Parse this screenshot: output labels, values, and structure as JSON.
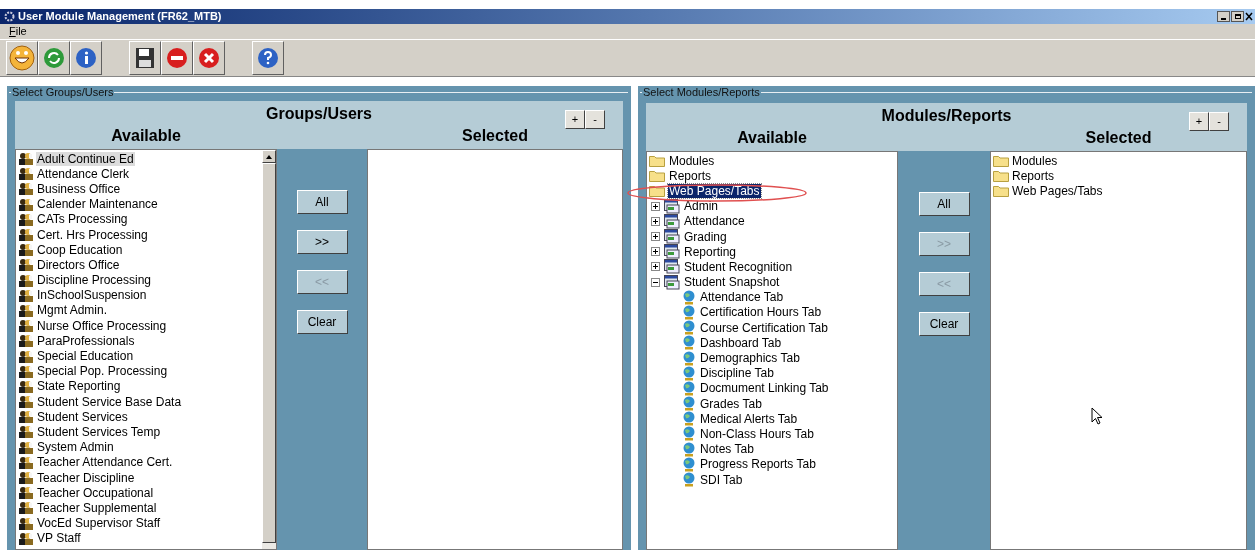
{
  "window": {
    "title": "User Module Management (FR62_MTB)"
  },
  "menu": [
    {
      "label": "File"
    }
  ],
  "groups_panel": {
    "legend": "Select Groups/Users",
    "title": "Groups/Users",
    "available_label": "Available",
    "selected_label": "Selected",
    "expand_button": "+",
    "collapse_button": "-",
    "available": [
      {
        "label": "Adult Continue Ed",
        "selected": true
      },
      {
        "label": "Attendance Clerk",
        "selected": false
      },
      {
        "label": "Business Office",
        "selected": false
      },
      {
        "label": "Calender Maintenance",
        "selected": false
      },
      {
        "label": "CATs Processing",
        "selected": false
      },
      {
        "label": "Cert. Hrs Processing",
        "selected": false
      },
      {
        "label": "Coop Education",
        "selected": false
      },
      {
        "label": "Directors Office",
        "selected": false
      },
      {
        "label": "Discipline Processing",
        "selected": false
      },
      {
        "label": "InSchoolSuspension",
        "selected": false
      },
      {
        "label": "Mgmt Admin.",
        "selected": false
      },
      {
        "label": "Nurse Office Processing",
        "selected": false
      },
      {
        "label": "ParaProfessionals",
        "selected": false
      },
      {
        "label": "Special Education",
        "selected": false
      },
      {
        "label": "Special Pop. Processing",
        "selected": false
      },
      {
        "label": "State Reporting",
        "selected": false
      },
      {
        "label": "Student Service Base Data",
        "selected": false
      },
      {
        "label": "Student Services",
        "selected": false
      },
      {
        "label": "Student Services Temp",
        "selected": false
      },
      {
        "label": "System Admin",
        "selected": false
      },
      {
        "label": "Teacher Attendance Cert.",
        "selected": false
      },
      {
        "label": "Teacher Discipline",
        "selected": false
      },
      {
        "label": "Teacher Occupational",
        "selected": false
      },
      {
        "label": "Teacher Supplemental",
        "selected": false
      },
      {
        "label": "VocEd Supervisor Staff",
        "selected": false
      },
      {
        "label": "VP Staff",
        "selected": false
      }
    ],
    "buttons": [
      {
        "label": "All",
        "disabled": false
      },
      {
        "label": ">>",
        "disabled": false
      },
      {
        "label": "<<",
        "disabled": true
      },
      {
        "label": "Clear",
        "disabled": false
      }
    ]
  },
  "modules_panel": {
    "legend": "Select Modules/Reports",
    "title": "Modules/Reports",
    "available_label": "Available",
    "selected_label": "Selected",
    "expand_button": "+",
    "collapse_button": "-",
    "available": [
      {
        "label": "Modules",
        "kind": "folder",
        "selected": false
      },
      {
        "label": "Reports",
        "kind": "folder",
        "selected": false
      },
      {
        "label": "Web Pages/Tabs",
        "kind": "folder",
        "selected": true,
        "children": [
          {
            "label": "Admin",
            "kind": "module",
            "selected": false,
            "expanded": false
          },
          {
            "label": "Attendance",
            "kind": "module",
            "selected": false,
            "expanded": false
          },
          {
            "label": "Grading",
            "kind": "module",
            "selected": false,
            "expanded": false
          },
          {
            "label": "Reporting",
            "kind": "module",
            "selected": false,
            "expanded": false
          },
          {
            "label": "Student Recognition",
            "kind": "module",
            "selected": false,
            "expanded": false
          },
          {
            "label": "Student Snapshot",
            "kind": "module",
            "selected": false,
            "expanded": true,
            "children": [
              {
                "label": "Attendance Tab",
                "kind": "page",
                "selected": false
              },
              {
                "label": "Certification Hours Tab",
                "kind": "page",
                "selected": false
              },
              {
                "label": "Course Certification Tab",
                "kind": "page",
                "selected": false
              },
              {
                "label": "Dashboard Tab",
                "kind": "page",
                "selected": false
              },
              {
                "label": "Demographics Tab",
                "kind": "page",
                "selected": false
              },
              {
                "label": "Discipline Tab",
                "kind": "page",
                "selected": false
              },
              {
                "label": "Docmument Linking Tab",
                "kind": "page",
                "selected": false
              },
              {
                "label": "Grades Tab",
                "kind": "page",
                "selected": false
              },
              {
                "label": "Medical Alerts Tab",
                "kind": "page",
                "selected": false
              },
              {
                "label": "Non-Class Hours Tab",
                "kind": "page",
                "selected": false
              },
              {
                "label": "Notes Tab",
                "kind": "page",
                "selected": false
              },
              {
                "label": "Progress Reports Tab",
                "kind": "page",
                "selected": false
              },
              {
                "label": "SDI Tab",
                "kind": "page",
                "selected": false
              }
            ]
          }
        ]
      }
    ],
    "buttons": [
      {
        "label": "All",
        "disabled": false
      },
      {
        "label": ">>",
        "disabled": true
      },
      {
        "label": "<<",
        "disabled": true
      },
      {
        "label": "Clear",
        "disabled": false
      }
    ],
    "selected": [
      {
        "label": "Modules",
        "kind": "folder"
      },
      {
        "label": "Reports",
        "kind": "folder"
      },
      {
        "label": "Web Pages/Tabs",
        "kind": "folder"
      }
    ]
  }
}
